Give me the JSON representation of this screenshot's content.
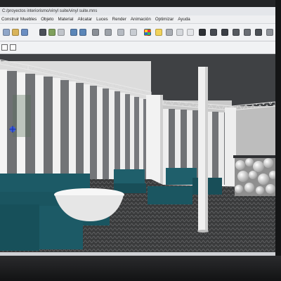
{
  "window": {
    "title": "C:/proyectos interiorismo/vinyl suite/vinyl suite.mns"
  },
  "menu": {
    "items": [
      "Construir Muebles",
      "Objeto",
      "Material",
      "Alicatar",
      "Luces",
      "Render",
      "Animación",
      "Optimizar",
      "Ayuda"
    ]
  },
  "toolbar": {
    "icons": [
      "new-icon",
      "open-icon",
      "save-icon",
      "cut-icon",
      "copy-icon",
      "paste-icon",
      "undo-icon",
      "redo-icon",
      "move-icon",
      "rotate-icon",
      "scale-icon",
      "select-icon",
      "material-icon",
      "light-icon",
      "camera-icon",
      "render-icon",
      "texture-icon",
      "layers-icon",
      "cursor-icon",
      "pen-icon",
      "lamp-icon",
      "paint-icon",
      "brush-icon",
      "settings-icon"
    ]
  },
  "colors": {
    "sofa": "#1c5a66",
    "floor": "#3a3b3c",
    "ceiling": "#3f4144",
    "wall_stripe_dark": "#6f7174",
    "wall_stripe_light": "#f4f4f4",
    "truss": "#e8e8e8"
  }
}
